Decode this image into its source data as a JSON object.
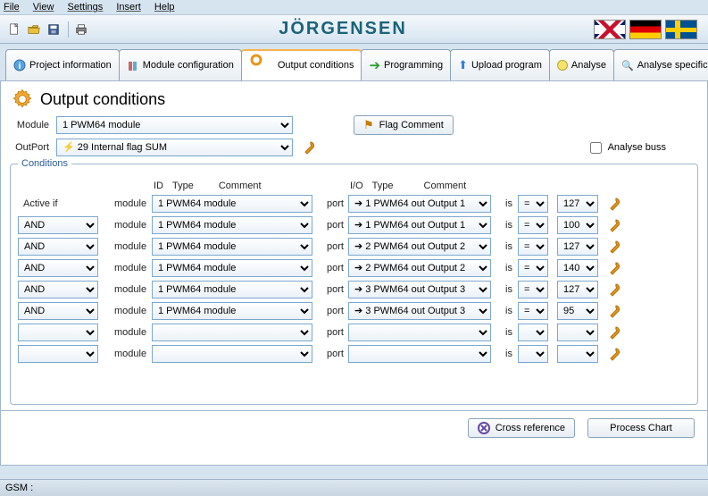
{
  "menu": {
    "file": "File",
    "view": "View",
    "settings": "Settings",
    "insert": "Insert",
    "help": "Help"
  },
  "brand": "JÖRGENSEN",
  "tabs": {
    "project": "Project information",
    "module": "Module configuration",
    "output": "Output conditions",
    "programming": "Programming",
    "upload": "Upload program",
    "analyse": "Analyse",
    "analyse_specific": "Analyse specific"
  },
  "page": {
    "title": "Output conditions",
    "module_label": "Module",
    "module_value": "1 PWM64 module",
    "outport_label": "OutPort",
    "outport_value": "29 Internal flag SUM",
    "flag_comment_btn": "Flag Comment",
    "analyse_buss": "Analyse buss"
  },
  "conditions": {
    "legend": "Conditions",
    "active_if": "Active if",
    "module_lbl": "module",
    "port_lbl": "port",
    "is_lbl": "is",
    "header_left": [
      "ID",
      "Type",
      "Comment"
    ],
    "header_right": [
      "I/O",
      "Type",
      "Comment"
    ],
    "rows": [
      {
        "logic": "",
        "module": "1 PWM64 module",
        "port": "1  PWM64 out  Output 1",
        "op": "=",
        "val": "127"
      },
      {
        "logic": "AND",
        "module": "1 PWM64 module",
        "port": "1  PWM64 out  Output 1",
        "op": "=",
        "val": "100"
      },
      {
        "logic": "AND",
        "module": "1 PWM64 module",
        "port": "2  PWM64 out  Output 2",
        "op": "=",
        "val": "127"
      },
      {
        "logic": "AND",
        "module": "1 PWM64 module",
        "port": "2  PWM64 out  Output 2",
        "op": "=",
        "val": "140"
      },
      {
        "logic": "AND",
        "module": "1 PWM64 module",
        "port": "3  PWM64 out  Output 3",
        "op": "=",
        "val": "127"
      },
      {
        "logic": "AND",
        "module": "1 PWM64 module",
        "port": "3  PWM64 out  Output 3",
        "op": "=",
        "val": "95"
      },
      {
        "logic": "",
        "module": "",
        "port": "",
        "op": "",
        "val": ""
      },
      {
        "logic": "",
        "module": "",
        "port": "",
        "op": "",
        "val": ""
      }
    ]
  },
  "footer": {
    "cross_ref": "Cross reference",
    "process_chart": "Process Chart"
  },
  "status": {
    "gsm": "GSM :"
  }
}
